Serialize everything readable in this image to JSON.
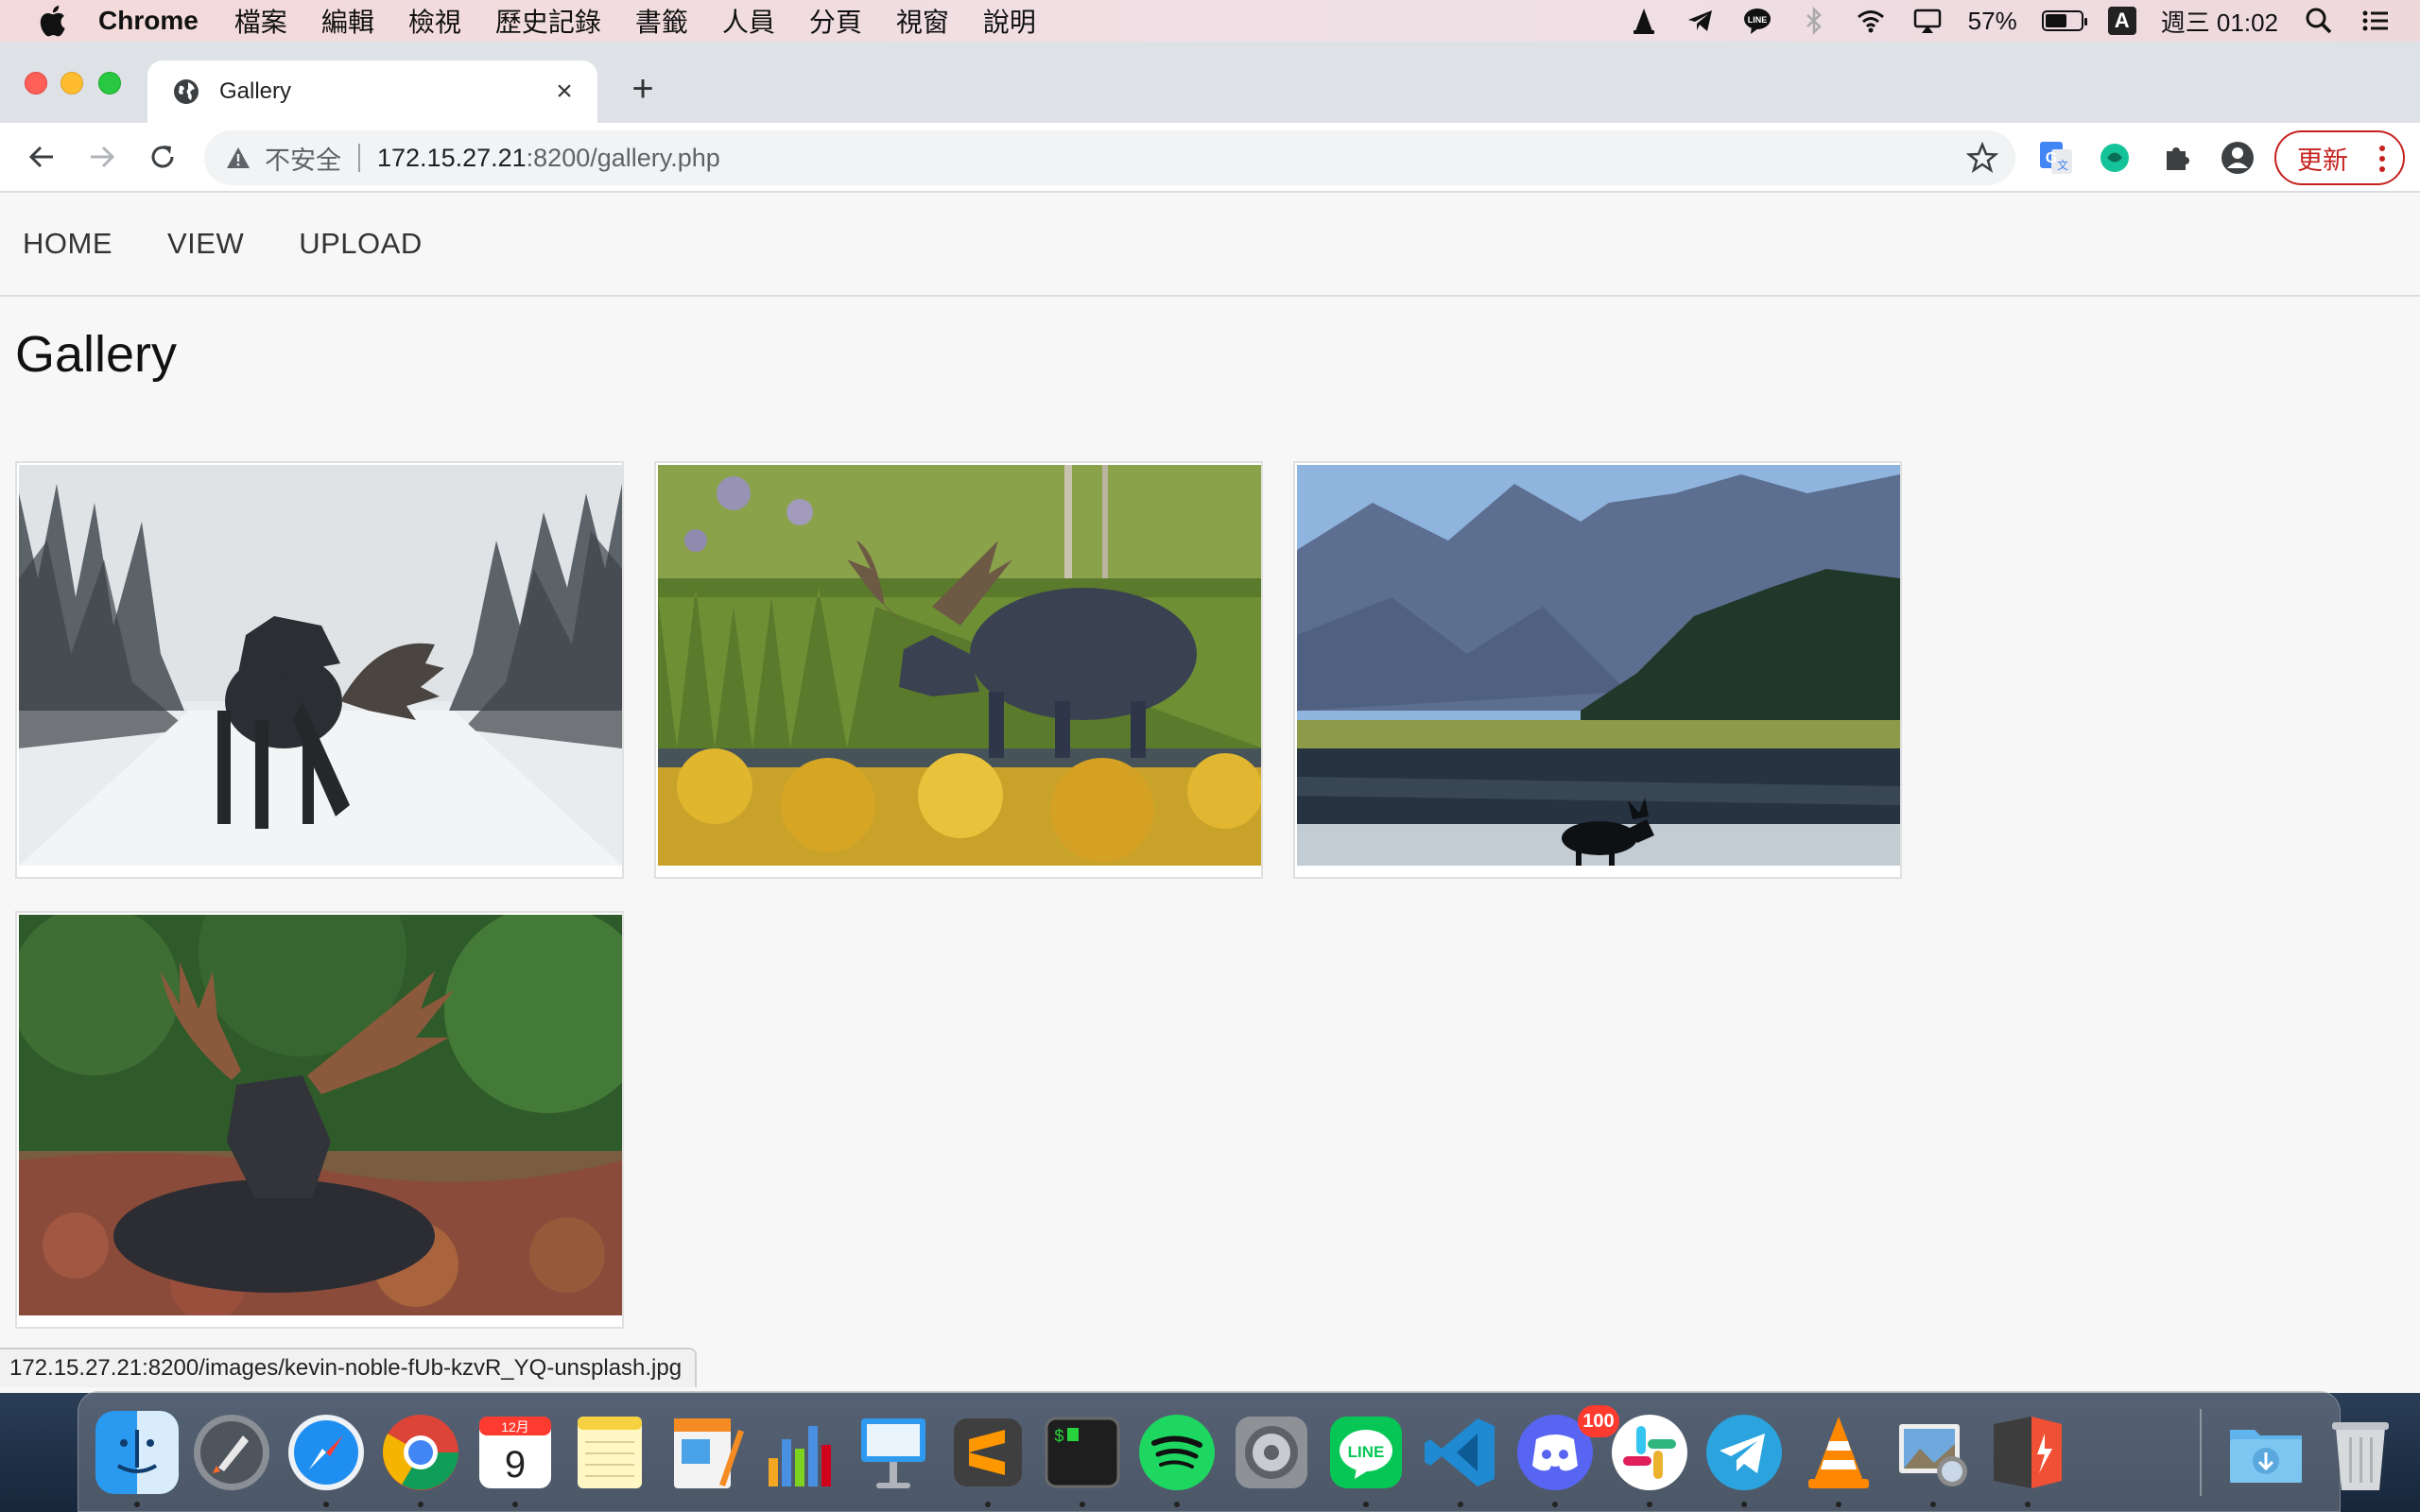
{
  "menubar": {
    "app_name": "Chrome",
    "menus": [
      "檔案",
      "編輯",
      "檢視",
      "歷史記錄",
      "書籤",
      "人員",
      "分頁",
      "視窗",
      "說明"
    ],
    "battery_percent": "57%",
    "input_source": "A",
    "clock": "週三 01:02",
    "line_label": "LINE"
  },
  "browser": {
    "tab_title": "Gallery",
    "close_glyph": "×",
    "newtab_glyph": "+",
    "security_label": "不安全",
    "url_host": "172.15.27.21",
    "url_path": ":8200/gallery.php",
    "update_label": "更新"
  },
  "site": {
    "nav": [
      "HOME",
      "VIEW",
      "UPLOAD"
    ],
    "page_title": "Gallery",
    "photos": [
      {
        "subject": "moose on snowy road"
      },
      {
        "subject": "moose walking in meadow stream"
      },
      {
        "subject": "moose in mountain lake"
      },
      {
        "subject": "moose resting in autumn grass"
      }
    ]
  },
  "status_url": "172.15.27.21:8200/images/kevin-noble-fUb-kzvR_YQ-unsplash.jpg",
  "dock": {
    "calendar_month": "12月",
    "calendar_day": "9",
    "discord_badge": "100",
    "apps": [
      "Finder",
      "Launchpad",
      "Safari",
      "Chrome",
      "Calendar",
      "Notes",
      "Pages",
      "Numbers",
      "Keynote",
      "Sublime Text",
      "Terminal",
      "Spotify",
      "System Preferences",
      "LINE",
      "Visual Studio Code",
      "Discord",
      "Slack",
      "Telegram",
      "VLC",
      "Preview",
      "Git",
      "Downloads",
      "Trash"
    ]
  }
}
